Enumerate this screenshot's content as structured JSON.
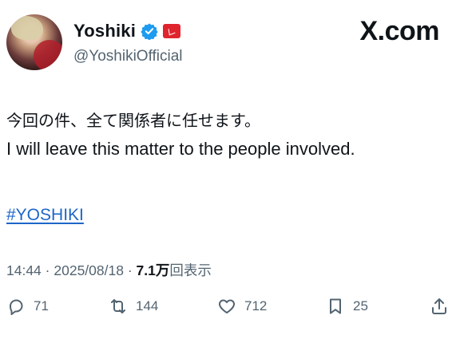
{
  "user": {
    "display_name": "Yoshiki",
    "handle": "@YoshikiOfficial",
    "verified_icon": "verified-badge-icon",
    "affiliate_icon": "affiliate-badge-icon"
  },
  "brand": {
    "label": "X.com"
  },
  "tweet": {
    "line_jp": "今回の件、全て関係者に任せます。",
    "line_en": "I will leave this matter to the people involved.",
    "hashtag": "#YOSHIKI"
  },
  "meta": {
    "time": "14:44",
    "separator": "·",
    "date": "2025/08/18",
    "views_count": "7.1万",
    "views_label": "回表示"
  },
  "actions": {
    "reply": {
      "icon": "reply-icon",
      "count": "71"
    },
    "repost": {
      "icon": "repost-icon",
      "count": "144"
    },
    "like": {
      "icon": "heart-icon",
      "count": "712"
    },
    "bookmark": {
      "icon": "bookmark-icon",
      "count": "25"
    },
    "share": {
      "icon": "share-icon"
    }
  },
  "colors": {
    "link": "#1d66c9",
    "verified": "#1d9bf0",
    "affiliate": "#e0242e",
    "muted": "#536471"
  }
}
